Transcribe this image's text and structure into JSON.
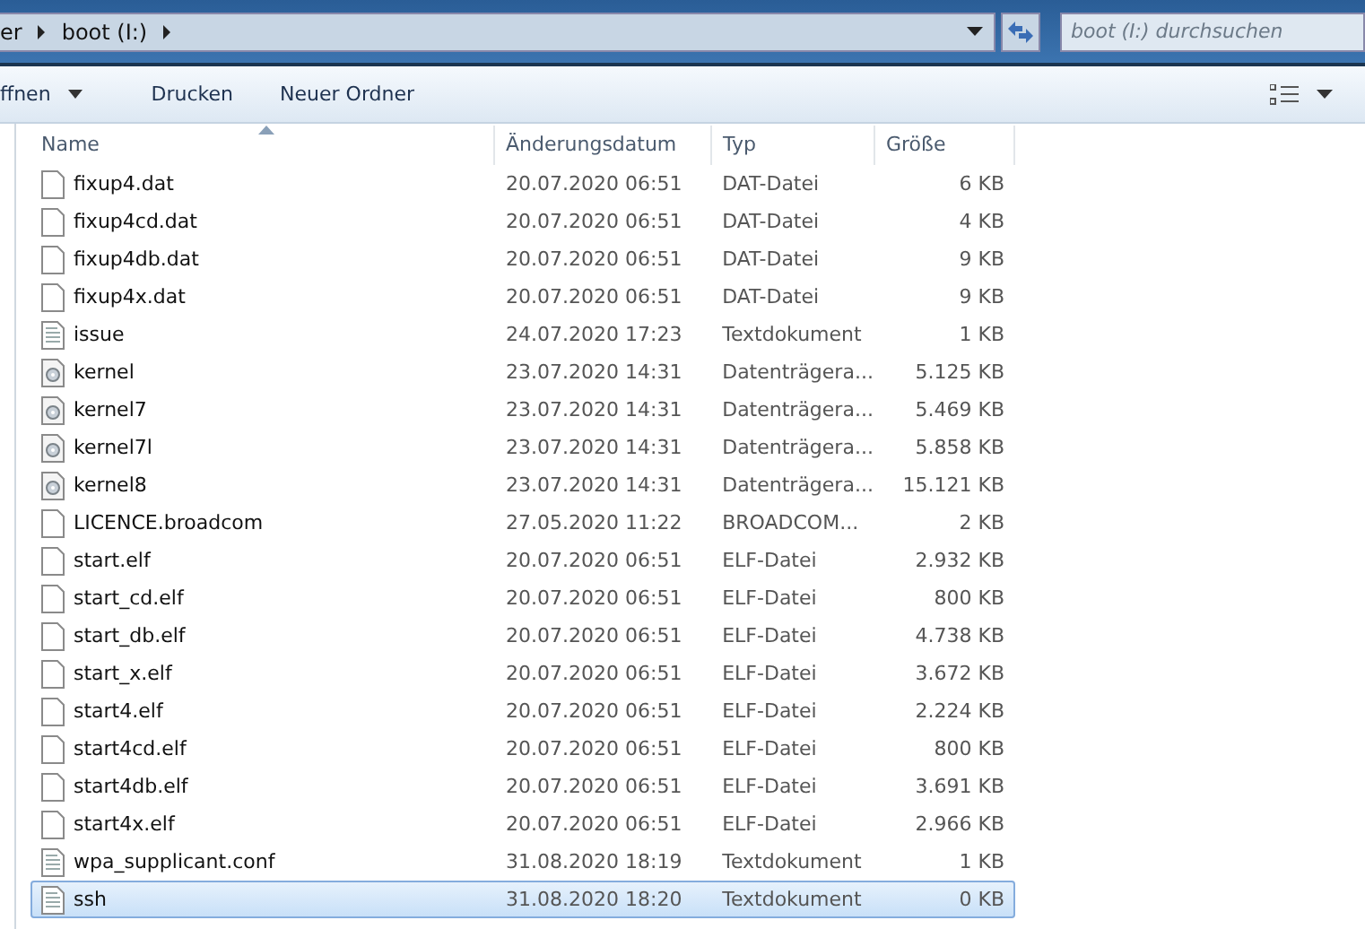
{
  "address_bar": {
    "crumbs": [
      "er",
      "boot (I:)"
    ]
  },
  "search": {
    "placeholder": "boot (I:) durchsuchen"
  },
  "toolbar": {
    "buttons": [
      {
        "label": "ffnen",
        "dropdown": true
      },
      {
        "label": "Drucken",
        "dropdown": false
      },
      {
        "label": "Neuer Ordner",
        "dropdown": false
      }
    ]
  },
  "table": {
    "columns": [
      "Name",
      "Änderungsdatum",
      "Typ",
      "Größe"
    ],
    "rows": [
      {
        "kind": "file",
        "name": "fixup4.dat",
        "date": "20.07.2020 06:51",
        "type": "DAT-Datei",
        "size": "6 KB",
        "selected": false
      },
      {
        "kind": "file",
        "name": "fixup4cd.dat",
        "date": "20.07.2020 06:51",
        "type": "DAT-Datei",
        "size": "4 KB",
        "selected": false
      },
      {
        "kind": "file",
        "name": "fixup4db.dat",
        "date": "20.07.2020 06:51",
        "type": "DAT-Datei",
        "size": "9 KB",
        "selected": false
      },
      {
        "kind": "file",
        "name": "fixup4x.dat",
        "date": "20.07.2020 06:51",
        "type": "DAT-Datei",
        "size": "9 KB",
        "selected": false
      },
      {
        "kind": "text",
        "name": "issue",
        "date": "24.07.2020 17:23",
        "type": "Textdokument",
        "size": "1 KB",
        "selected": false
      },
      {
        "kind": "disk",
        "name": "kernel",
        "date": "23.07.2020 14:31",
        "type": "Datenträgera...",
        "size": "5.125 KB",
        "selected": false
      },
      {
        "kind": "disk",
        "name": "kernel7",
        "date": "23.07.2020 14:31",
        "type": "Datenträgera...",
        "size": "5.469 KB",
        "selected": false
      },
      {
        "kind": "disk",
        "name": "kernel7l",
        "date": "23.07.2020 14:31",
        "type": "Datenträgera...",
        "size": "5.858 KB",
        "selected": false
      },
      {
        "kind": "disk",
        "name": "kernel8",
        "date": "23.07.2020 14:31",
        "type": "Datenträgera...",
        "size": "15.121 KB",
        "selected": false
      },
      {
        "kind": "file",
        "name": "LICENCE.broadcom",
        "date": "27.05.2020 11:22",
        "type": "BROADCOM...",
        "size": "2 KB",
        "selected": false
      },
      {
        "kind": "file",
        "name": "start.elf",
        "date": "20.07.2020 06:51",
        "type": "ELF-Datei",
        "size": "2.932 KB",
        "selected": false
      },
      {
        "kind": "file",
        "name": "start_cd.elf",
        "date": "20.07.2020 06:51",
        "type": "ELF-Datei",
        "size": "800 KB",
        "selected": false
      },
      {
        "kind": "file",
        "name": "start_db.elf",
        "date": "20.07.2020 06:51",
        "type": "ELF-Datei",
        "size": "4.738 KB",
        "selected": false
      },
      {
        "kind": "file",
        "name": "start_x.elf",
        "date": "20.07.2020 06:51",
        "type": "ELF-Datei",
        "size": "3.672 KB",
        "selected": false
      },
      {
        "kind": "file",
        "name": "start4.elf",
        "date": "20.07.2020 06:51",
        "type": "ELF-Datei",
        "size": "2.224 KB",
        "selected": false
      },
      {
        "kind": "file",
        "name": "start4cd.elf",
        "date": "20.07.2020 06:51",
        "type": "ELF-Datei",
        "size": "800 KB",
        "selected": false
      },
      {
        "kind": "file",
        "name": "start4db.elf",
        "date": "20.07.2020 06:51",
        "type": "ELF-Datei",
        "size": "3.691 KB",
        "selected": false
      },
      {
        "kind": "file",
        "name": "start4x.elf",
        "date": "20.07.2020 06:51",
        "type": "ELF-Datei",
        "size": "2.966 KB",
        "selected": false
      },
      {
        "kind": "text",
        "name": "wpa_supplicant.conf",
        "date": "31.08.2020 18:19",
        "type": "Textdokument",
        "size": "1 KB",
        "selected": false
      },
      {
        "kind": "text",
        "name": "ssh",
        "date": "31.08.2020 18:20",
        "type": "Textdokument",
        "size": "0 KB",
        "selected": true
      }
    ]
  }
}
